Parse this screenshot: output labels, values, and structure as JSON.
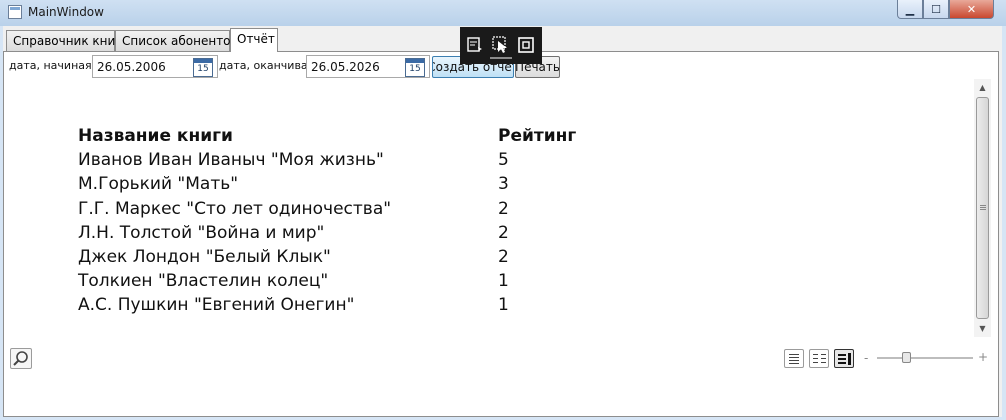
{
  "window": {
    "title": "MainWindow"
  },
  "tabs": [
    {
      "label": "Справочник книг"
    },
    {
      "label": "Список абонентов"
    },
    {
      "label": "Отчёт"
    }
  ],
  "filters": {
    "start_label": "дата, начиная с",
    "start_date": "26.05.2006",
    "end_label": "дата, оканчивая",
    "end_date": "26.05.2026",
    "calendar_day": "15",
    "create_button": "Создать отчёт",
    "print_button": "Печать"
  },
  "report": {
    "col_title": "Название книги",
    "col_rating": "Рейтинг",
    "rows": [
      {
        "title": "Иванов Иван Иваныч \"Моя жизнь\"",
        "rating": "5"
      },
      {
        "title": "М.Горький \"Мать\"",
        "rating": "3"
      },
      {
        "title": "Г.Г. Маркес \"Сто лет одиночества\"",
        "rating": "2"
      },
      {
        "title": "Л.Н. Толстой \"Война и мир\"",
        "rating": "2"
      },
      {
        "title": "Джек Лондон \"Белый Клык\"",
        "rating": "2"
      },
      {
        "title": "Толкиен \"Властелин колец\"",
        "rating": "1"
      },
      {
        "title": "А.С. Пушкин \"Евгений Онегин\"",
        "rating": "1"
      }
    ]
  },
  "viewer": {
    "zoom_minus": "-",
    "zoom_plus": "+"
  }
}
